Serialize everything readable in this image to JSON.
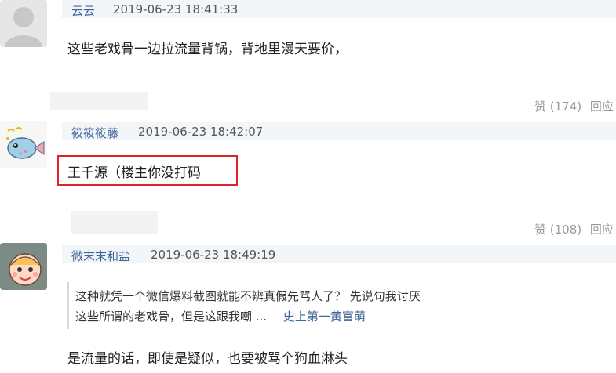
{
  "comments": [
    {
      "user": "云云",
      "time": "2019-06-23 18:41:33",
      "text": "这些老戏骨一边拉流量背锅，背地里漫天要价，",
      "likes_label": "赞 (174)",
      "reply_label": "回应"
    },
    {
      "user": "筱筱筱藤",
      "time": "2019-06-23 18:42:07",
      "text": "王千源（楼主你没打码",
      "likes_label": "赞 (108)",
      "reply_label": "回应"
    },
    {
      "user": "微末末和盐",
      "time": "2019-06-23 18:49:19",
      "quote_line1": "这种就凭一个微信爆料截图就能不辨真假先骂人了？ 先说句我讨厌",
      "quote_line2": "这些所谓的老戏骨，但是这跟我嘲 ...",
      "quote_author": "史上第一黄富萌",
      "text": "是流量的话，即使是疑似，也要被骂个狗血淋头"
    }
  ],
  "colors": {
    "username": "#406599",
    "highlight_border": "#e0202a",
    "meta_bg": "#f3f6f9"
  },
  "icons": {
    "avatar1": "default-person-avatar",
    "avatar2": "cartoon-fish-avatar",
    "avatar3": "cartoon-character-avatar"
  }
}
